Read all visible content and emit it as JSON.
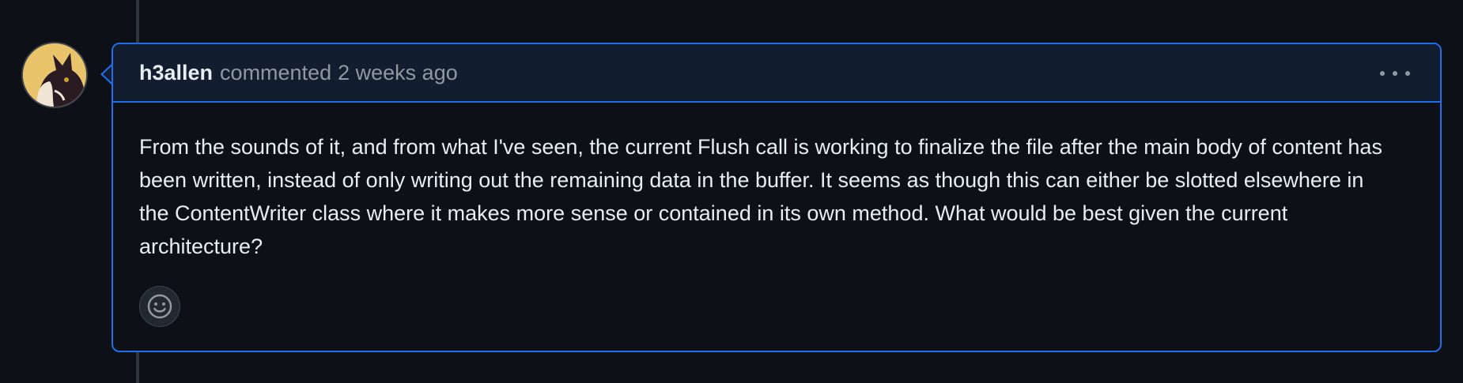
{
  "comment": {
    "author": "h3allen",
    "action": "commented",
    "timestamp": "2 weeks ago",
    "body": "From the sounds of it, and from what I've seen, the current Flush call is working to finalize the file after the main body of content has been written, instead of only writing out the remaining data in the buffer. It seems as though this can either be slotted elsewhere in the ContentWriter class where it makes more sense or contained in its own method. What would be best given the current architecture?"
  },
  "icons": {
    "menu": "kebab-horizontal-icon",
    "reaction": "smiley-icon"
  },
  "colors": {
    "background": "#0d1117",
    "accent_border": "#1f6feb",
    "header_bg": "#121d2f",
    "muted_text": "#9198a1"
  }
}
